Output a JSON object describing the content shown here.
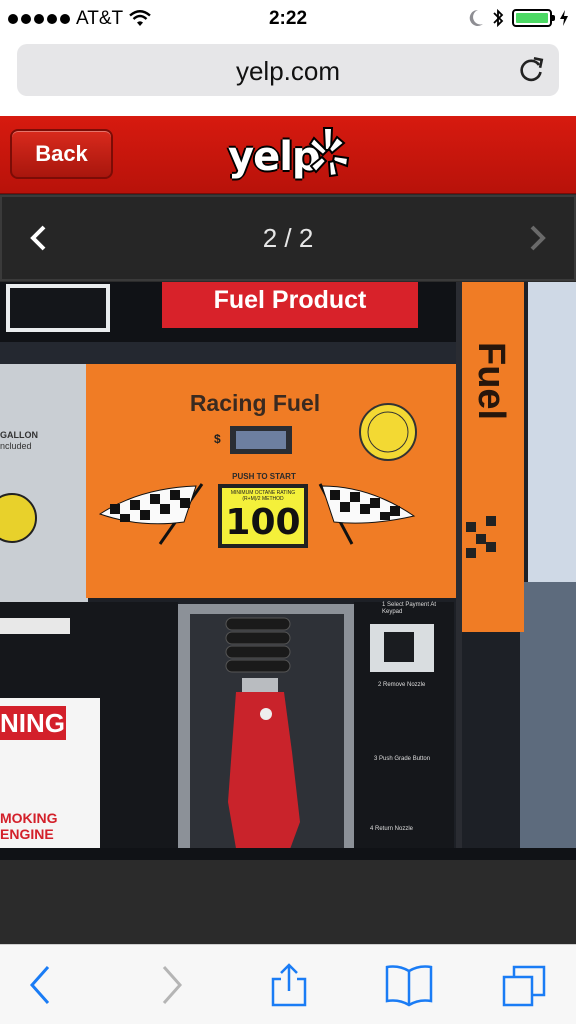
{
  "status_bar": {
    "carrier": "AT&T",
    "time": "2:22"
  },
  "browser": {
    "url": "yelp.com"
  },
  "header": {
    "back_label": "Back",
    "logo_text": "yelp"
  },
  "gallery": {
    "counter": "2 / 2"
  },
  "photo": {
    "fuel_product_label": "Fuel Product",
    "racing_fuel_label": "Racing Fuel",
    "push_to_start": "PUSH TO START",
    "octane_rating_caption": "MINIMUM OCTANE RATING (R+M)/2 METHOD",
    "octane_value": "100",
    "side_banner_text": "Fuel",
    "price_symbol": "$",
    "gallon_text": "GALLON",
    "included_text": "ncluded",
    "warning_text": "NING",
    "no_smoking_line1": "MOKING",
    "no_smoking_line2": "ENGINE",
    "step1": "1 Select Payment At Keypad",
    "step2": "2 Remove Nozzle",
    "step3": "3 Push Grade Button",
    "step4": "4 Return Nozzle"
  },
  "colors": {
    "yelp_red": "#c4160c",
    "pump_orange": "#f07c25",
    "ios_blue": "#1a7cf5"
  }
}
